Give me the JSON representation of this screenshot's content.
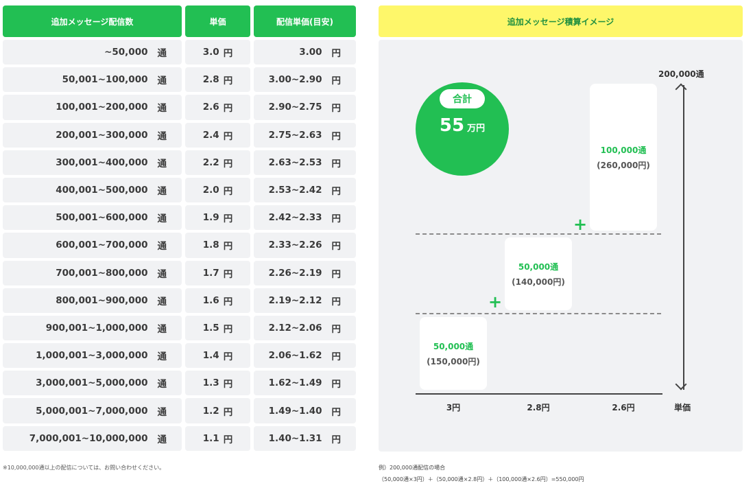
{
  "table": {
    "headers": [
      "追加メッセージ配信数",
      "単価",
      "配信単価(目安)"
    ],
    "count_unit": "通",
    "price_unit": "円",
    "rows": [
      {
        "range": "~50,000",
        "price": "3.0",
        "estimate": "3.00"
      },
      {
        "range": "50,001~100,000",
        "price": "2.8",
        "estimate": "3.00~2.90"
      },
      {
        "range": "100,001~200,000",
        "price": "2.6",
        "estimate": "2.90~2.75"
      },
      {
        "range": "200,001~300,000",
        "price": "2.4",
        "estimate": "2.75~2.63"
      },
      {
        "range": "300,001~400,000",
        "price": "2.2",
        "estimate": "2.63~2.53"
      },
      {
        "range": "400,001~500,000",
        "price": "2.0",
        "estimate": "2.53~2.42"
      },
      {
        "range": "500,001~600,000",
        "price": "1.9",
        "estimate": "2.42~2.33"
      },
      {
        "range": "600,001~700,000",
        "price": "1.8",
        "estimate": "2.33~2.26"
      },
      {
        "range": "700,001~800,000",
        "price": "1.7",
        "estimate": "2.26~2.19"
      },
      {
        "range": "800,001~900,000",
        "price": "1.6",
        "estimate": "2.19~2.12"
      },
      {
        "range": "900,001~1,000,000",
        "price": "1.5",
        "estimate": "2.12~2.06"
      },
      {
        "range": "1,000,001~3,000,000",
        "price": "1.4",
        "estimate": "2.06~1.62"
      },
      {
        "range": "3,000,001~5,000,000",
        "price": "1.3",
        "estimate": "1.62~1.49"
      },
      {
        "range": "5,000,001~7,000,000",
        "price": "1.2",
        "estimate": "1.49~1.40"
      },
      {
        "range": "7,000,001~10,000,000",
        "price": "1.1",
        "estimate": "1.40~1.31"
      }
    ],
    "note": "※10,000,000通以上の配信については、お問い合わせください。"
  },
  "diagram": {
    "title": "追加メッセージ積算イメージ",
    "total_label": "合計",
    "total_value": "55",
    "total_unit": "万円",
    "tiers": [
      {
        "count": "50,000通",
        "amount": "(150,000円)",
        "price_label": "3円"
      },
      {
        "count": "50,000通",
        "amount": "(140,000円)",
        "price_label": "2.8円"
      },
      {
        "count": "100,000通",
        "amount": "(260,000円)",
        "price_label": "2.6円"
      }
    ],
    "plus": "+",
    "y_axis_label": "200,000通",
    "x_axis_label": "単価",
    "example_title": "例）200,000通配信の場合",
    "example_formula": "（50,000通×3円）＋（50,000通×2.8円）＋（100,000通×2.6円）=550,000円"
  },
  "colors": {
    "green": "#22bf53",
    "yellow": "#fef76a",
    "panel": "#f1f2f4"
  }
}
